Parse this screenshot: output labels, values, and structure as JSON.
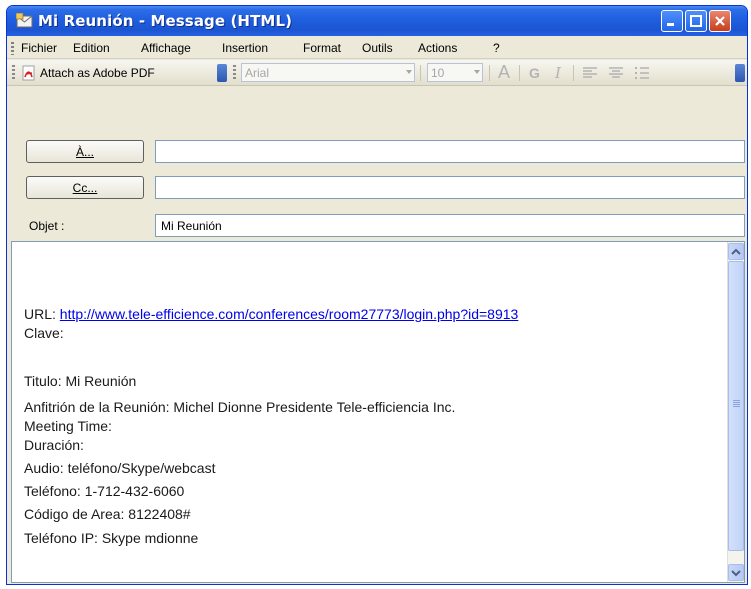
{
  "window": {
    "title": "Mi Reunión - Message (HTML)",
    "icon": "outlook-envelope-icon"
  },
  "menubar": {
    "items": [
      {
        "label": "Fichier",
        "mnemonic": "F"
      },
      {
        "label": "Edition",
        "mnemonic": "E"
      },
      {
        "label": "Affichage",
        "mnemonic": "A"
      },
      {
        "label": "Insertion",
        "mnemonic": "I"
      },
      {
        "label": "Format",
        "mnemonic": "t"
      },
      {
        "label": "Outils",
        "mnemonic": "O"
      },
      {
        "label": "Actions",
        "mnemonic": "s"
      },
      {
        "label": "?",
        "mnemonic": "?"
      }
    ]
  },
  "toolbar": {
    "attach_pdf_label": "Attach as Adobe PDF",
    "font_name": "Arial",
    "font_size": "10",
    "format_buttons": [
      "A",
      "G",
      "I"
    ]
  },
  "header": {
    "to_button": "À...",
    "cc_button": "Cc...",
    "subject_label": "Objet :",
    "to_value": "",
    "cc_value": "",
    "subject_value": "Mi Reunión"
  },
  "body": {
    "url_label": "URL:",
    "url_link": "http://www.tele-efficience.com/conferences/room27773/login.php?id=8913",
    "clave": "Clave:",
    "titulo": "Titulo: Mi Reunión",
    "anfitrion": "Anfitrión de la Reunión: Michel Dionne Presidente Tele-efficiencia Inc.",
    "meeting_time": "Meeting Time:",
    "duracion": "Duración:",
    "audio": "Audio: teléfono/Skype/webcast",
    "telefono": "Teléfono: 1-712-432-6060",
    "codigo": "Código de Area: 8122408#",
    "telefono_ip": "Teléfono IP: Skype mdionne"
  },
  "colors": {
    "titlebar": "#1f5fe0",
    "link": "#0000e6",
    "field_border": "#7f9db9"
  }
}
